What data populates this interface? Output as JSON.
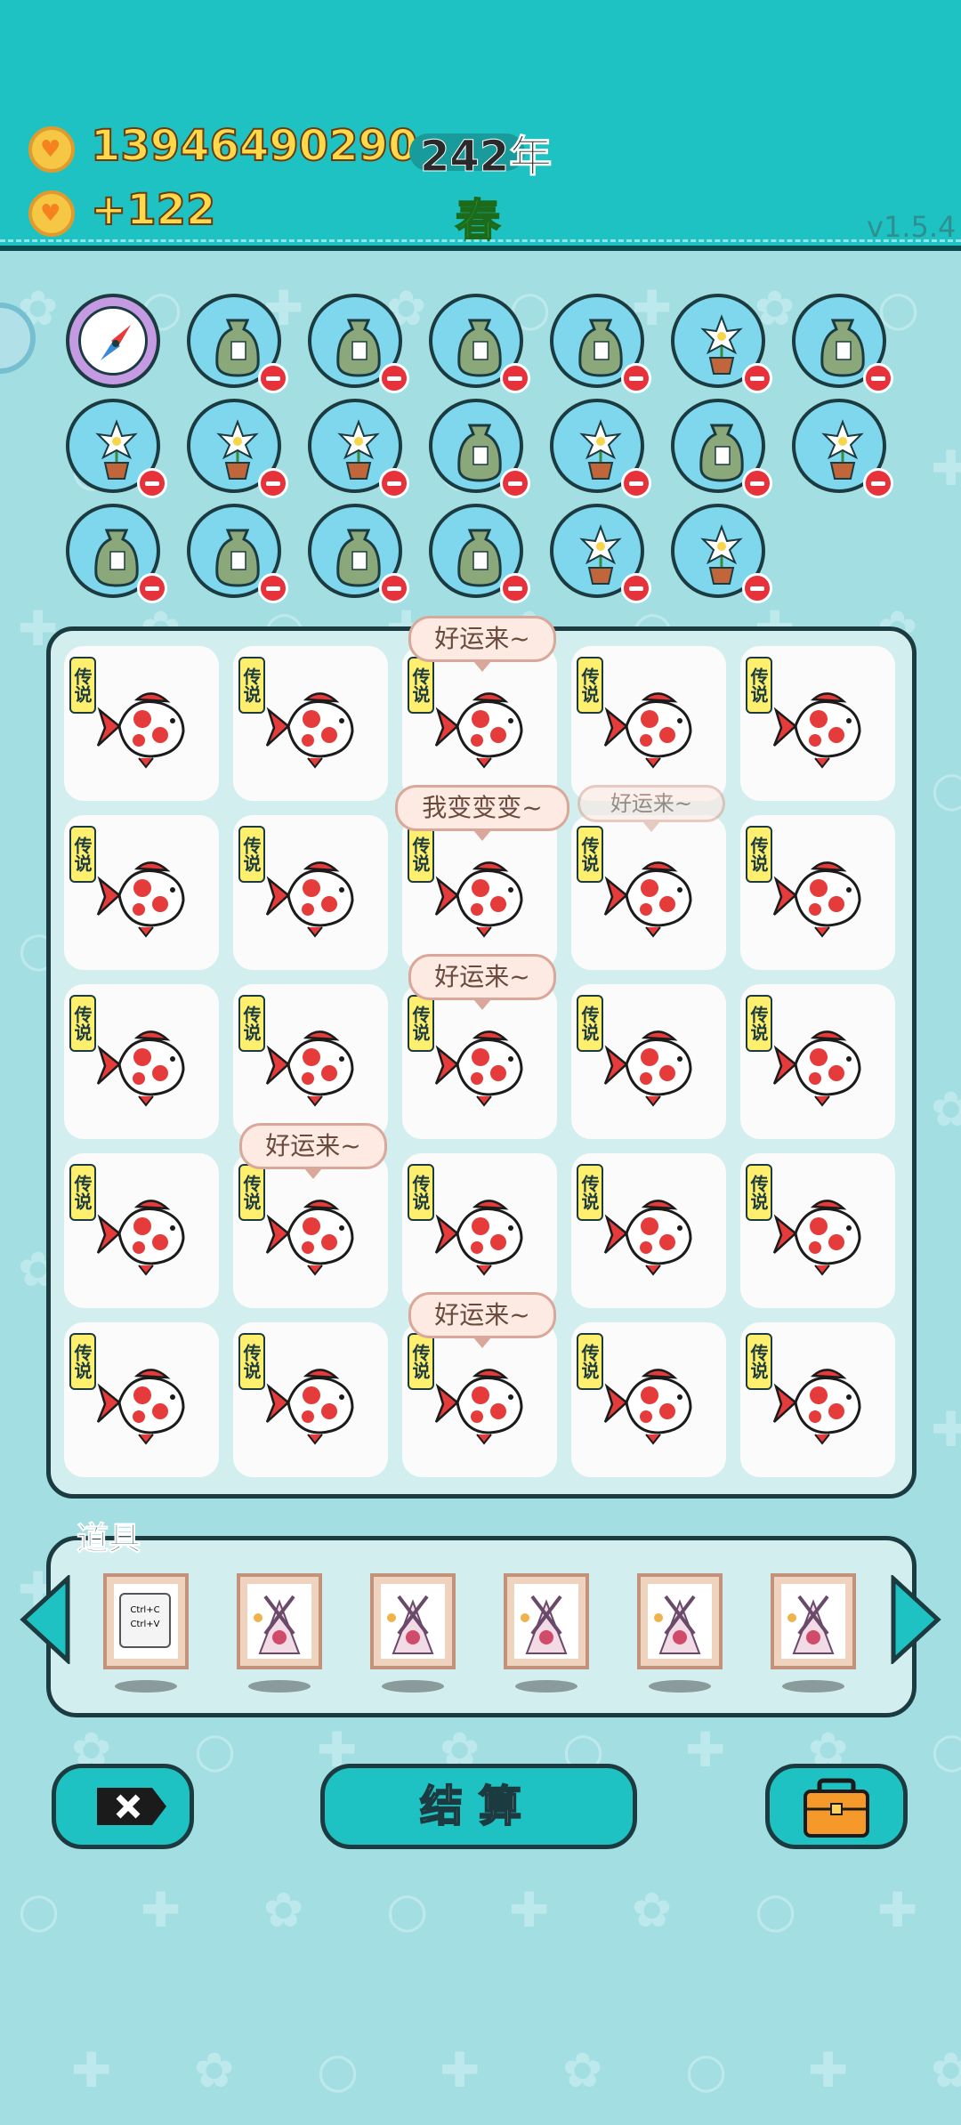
{
  "header": {
    "gold": "13946490290",
    "gold_delta": "+122",
    "year": "242年",
    "season": "春",
    "version": "v1.5.4"
  },
  "colors": {
    "topbar": "#1fc2c2",
    "background": "#a3dfe2",
    "board": "#d3eeee"
  },
  "inventory_items": [
    {
      "icon": "compass-icon",
      "removable": false
    },
    {
      "icon": "sack-icon",
      "removable": true
    },
    {
      "icon": "sack-icon",
      "removable": true
    },
    {
      "icon": "sack-icon",
      "removable": true
    },
    {
      "icon": "sack-icon",
      "removable": true
    },
    {
      "icon": "flower-pot-icon",
      "removable": true
    },
    {
      "icon": "sack-icon",
      "removable": true
    },
    {
      "icon": "flower-pot-icon",
      "removable": true
    },
    {
      "icon": "flower-pot-icon",
      "removable": true
    },
    {
      "icon": "flower-pot-icon",
      "removable": true
    },
    {
      "icon": "sack-icon",
      "removable": true
    },
    {
      "icon": "flower-pot-icon",
      "removable": true
    },
    {
      "icon": "sack-icon",
      "removable": true
    },
    {
      "icon": "flower-pot-icon",
      "removable": true
    },
    {
      "icon": "sack-icon",
      "removable": true
    },
    {
      "icon": "sack-icon",
      "removable": true
    },
    {
      "icon": "sack-icon",
      "removable": true
    },
    {
      "icon": "sack-icon",
      "removable": true
    },
    {
      "icon": "flower-pot-icon",
      "removable": true
    },
    {
      "icon": "flower-pot-icon",
      "removable": true
    }
  ],
  "board": {
    "rarity_tag": "传说",
    "cell_icon": "koi-fish-icon",
    "rows": 5,
    "cols": 5,
    "speech": [
      {
        "row": 0,
        "col": 2,
        "text": "好运来~"
      },
      {
        "row": 1,
        "col": 2,
        "text": "我变变变~"
      },
      {
        "row": 1,
        "col": 3,
        "text": "好运来~",
        "faded": true
      },
      {
        "row": 2,
        "col": 2,
        "text": "好运来~"
      },
      {
        "row": 3,
        "col": 1,
        "text": "好运来~"
      },
      {
        "row": 4,
        "col": 2,
        "text": "好运来~"
      }
    ]
  },
  "tools": {
    "title": "道具",
    "items": [
      {
        "icon": "copy-paste-icon",
        "label_1": "Ctrl+C",
        "label_2": "Ctrl+V"
      },
      {
        "icon": "broom-dustpan-icon"
      },
      {
        "icon": "broom-dustpan-icon"
      },
      {
        "icon": "broom-dustpan-icon"
      },
      {
        "icon": "broom-dustpan-icon"
      },
      {
        "icon": "broom-dustpan-icon"
      }
    ]
  },
  "buttons": {
    "delete_icon": "close-icon",
    "settle_label": "结算",
    "bag_icon": "briefcase-icon"
  }
}
